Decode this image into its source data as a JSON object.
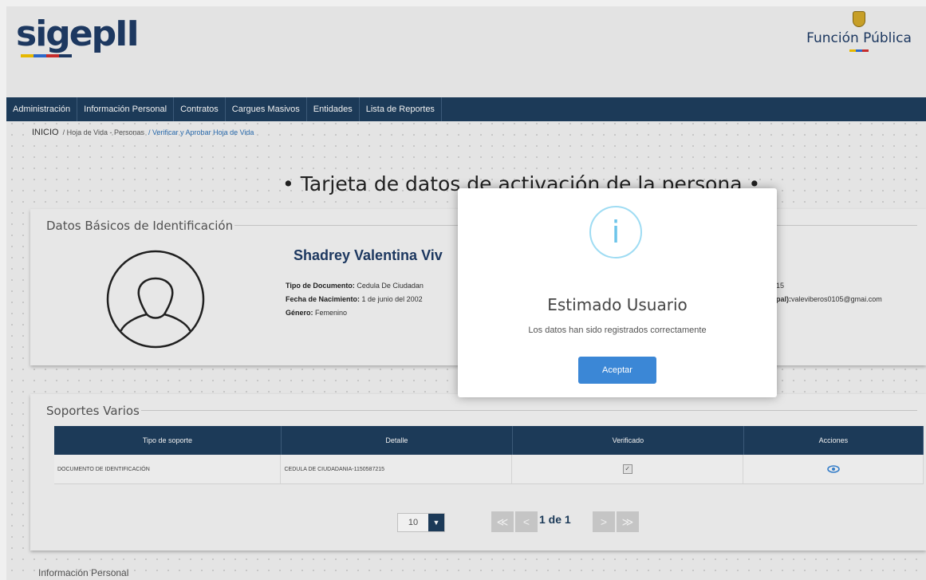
{
  "header": {
    "logo_text": "sigepII",
    "entity": "Función Pública",
    "colors": {
      "brand": "#1f3c66",
      "nav": "#1e3e5e",
      "accent": "#3b87d6"
    }
  },
  "nav": {
    "items": [
      "Administración",
      "Información Personal",
      "Contratos",
      "Cargues Masivos",
      "Entidades",
      "Lista de Reportes"
    ]
  },
  "breadcrumb": {
    "home": "INICIO",
    "level1": "/ Hoja de Vida - Personas",
    "level2": "/ Verificar y Aprobar Hoja de Vida"
  },
  "page_title": "• Tarjeta de datos de activación de la persona •",
  "basic_id": {
    "legend": "Datos Básicos de Identificación",
    "name": "Shadrey Valentina Viv",
    "avatar_icon": "female-user-icon",
    "fields": {
      "doc_type_label": "Tipo de Documento:",
      "doc_type_value": "Cedula De Ciudadan",
      "birth_label": "Fecha de Nacimiento:",
      "birth_value": "1 de junio del 2002",
      "gender_label": "Género:",
      "gender_value": "Femenino"
    },
    "right_fields": {
      "doc_number_fragment": "15",
      "email_label_fragment": "pal):",
      "email_value": "valeviberos0105@gmai.com"
    }
  },
  "supports": {
    "legend": "Soportes Varios",
    "columns": [
      "Tipo de soporte",
      "Detalle",
      "Verificado",
      "Acciones"
    ],
    "rows": [
      {
        "tipo": "DOCUMENTO DE IDENTIFICACIÓN",
        "detalle": "CEDULA DE CIUDADANIA-1150587215",
        "verificado_mark": "✓",
        "accion_icon": "eye-icon"
      }
    ],
    "pager": {
      "page_size": "10",
      "page_size_arrow": "▼",
      "page_info": "1 de 1",
      "first": "≪",
      "prev": "<",
      "next": ">",
      "last": "≫"
    }
  },
  "bottom_legend": "Información Personal",
  "modal": {
    "icon": "info-icon",
    "icon_glyph": "i",
    "title": "Estimado Usuario",
    "message": "Los datos han sido registrados correctamente",
    "button": "Aceptar"
  }
}
